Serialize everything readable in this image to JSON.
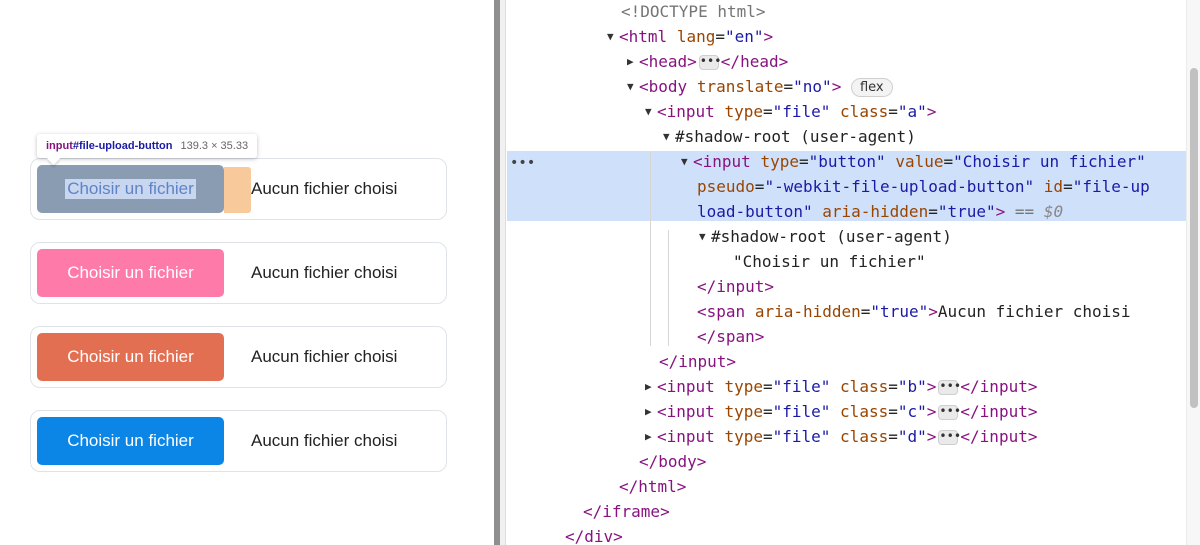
{
  "preview": {
    "tooltip": {
      "tag": "input",
      "id": "#file-upload-button",
      "dimensions": "139.3 × 35.33"
    },
    "inputs": [
      {
        "button_label": "Choisir un fichier",
        "status": "Aucun fichier choisi",
        "color": "#8a9cb2"
      },
      {
        "button_label": "Choisir un fichier",
        "status": "Aucun fichier choisi",
        "color": "#fe7aa8"
      },
      {
        "button_label": "Choisir un fichier",
        "status": "Aucun fichier choisi",
        "color": "#e36f53"
      },
      {
        "button_label": "Choisir un fichier",
        "status": "Aucun fichier choisi",
        "color": "#0b85e6"
      }
    ]
  },
  "devtools": {
    "doctype": "<!DOCTYPE html>",
    "html_open": {
      "tag": "<html",
      "attr": "lang",
      "value": "\"en\"",
      "close": ">"
    },
    "head": {
      "open": "<head>",
      "close": "</head>"
    },
    "body_open": {
      "tag": "<body",
      "attr": "translate",
      "value": "\"no\"",
      "close": ">",
      "badge": "flex"
    },
    "input_a": {
      "tag": "<input",
      "attr1": "type",
      "val1": "\"file\"",
      "attr2": "class",
      "val2": "\"a\"",
      "close": ">"
    },
    "shadow_root": "#shadow-root (user-agent)",
    "selected_line1": {
      "tag": "<input",
      "attr1": "type",
      "val1": "\"button\"",
      "attr2": "value",
      "val2": "\"Choisir un fichier\""
    },
    "selected_line2": {
      "attr": "pseudo",
      "val": "\"-webkit-file-upload-button\"",
      "attr2": "id",
      "val2": "\"file-up"
    },
    "selected_line3": {
      "val": "load-button\"",
      "attr": "aria-hidden",
      "val2": "\"true\"",
      "close": ">",
      "eq": " == ",
      "ref": "$0"
    },
    "inner_shadow_root": "#shadow-root (user-agent)",
    "inner_text": "\"Choisir un fichier\"",
    "input_close": "</input>",
    "span_open": {
      "tag": "<span",
      "attr": "aria-hidden",
      "val": "\"true\"",
      "close": ">",
      "text": "Aucun fichier choisi"
    },
    "span_close": "</span>",
    "input_a_close": "</input>",
    "inputs_collapsed": [
      {
        "tag": "<input",
        "attr1": "type",
        "val1": "\"file\"",
        "attr2": "class",
        "val2": "\"b\"",
        "close": ">",
        "end": "</input>"
      },
      {
        "tag": "<input",
        "attr1": "type",
        "val1": "\"file\"",
        "attr2": "class",
        "val2": "\"c\"",
        "close": ">",
        "end": "</input>"
      },
      {
        "tag": "<input",
        "attr1": "type",
        "val1": "\"file\"",
        "attr2": "class",
        "val2": "\"d\"",
        "close": ">",
        "end": "</input>"
      }
    ],
    "body_close": "</body>",
    "html_close": "</html>",
    "iframe_close": "</iframe>",
    "div_close": "</div>",
    "ellipsis": "•••",
    "row_menu": "•••"
  }
}
